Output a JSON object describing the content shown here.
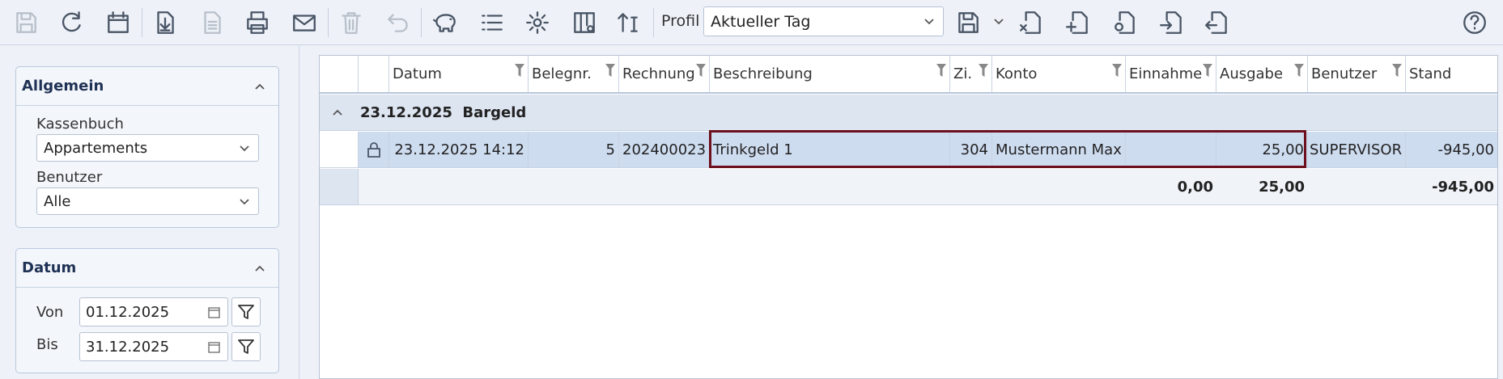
{
  "toolbar": {
    "buttons": [
      {
        "name": "save-icon",
        "enabled": false
      },
      {
        "name": "refresh-icon",
        "enabled": true
      },
      {
        "name": "calendar-icon",
        "enabled": true
      },
      {
        "name": "import-icon",
        "enabled": true
      },
      {
        "name": "document-icon",
        "enabled": false
      },
      {
        "name": "print-icon",
        "enabled": true
      },
      {
        "name": "mail-icon",
        "enabled": true
      },
      {
        "name": "delete-icon",
        "enabled": false
      },
      {
        "name": "undo-icon",
        "enabled": false
      },
      {
        "name": "piggy-bank-icon",
        "enabled": true
      },
      {
        "name": "list-icon",
        "enabled": true
      },
      {
        "name": "settings-icon",
        "enabled": true
      },
      {
        "name": "columns-settings-icon",
        "enabled": true
      },
      {
        "name": "sort-icon",
        "enabled": true
      }
    ],
    "profil_label": "Profil",
    "profil_value": "Aktueller Tag",
    "profile_buttons": [
      "save-profile-icon",
      "delete-profile-icon",
      "new-profile-icon",
      "profile-settings-icon",
      "export-profile-icon",
      "import-profile-icon"
    ],
    "help_icon": "help-icon"
  },
  "sidebar": {
    "allgemein": {
      "title": "Allgemein",
      "kassenbuch_label": "Kassenbuch",
      "kassenbuch_value": "Appartements",
      "benutzer_label": "Benutzer",
      "benutzer_value": "Alle"
    },
    "datum": {
      "title": "Datum",
      "von_label": "Von",
      "von_value": "01.12.2025",
      "bis_label": "Bis",
      "bis_value": "31.12.2025"
    }
  },
  "grid": {
    "columns": [
      "",
      "",
      "Datum",
      "Belegnr.",
      "Rechnung",
      "Beschreibung",
      "Zi.",
      "Konto",
      "Einnahme",
      "Ausgabe",
      "Benutzer",
      "Stand"
    ],
    "group_label": "23.12.2025  Bargeld",
    "row": {
      "lock_icon": "lock-icon",
      "datum": "23.12.2025 14:12",
      "belegnr": "5",
      "rechnung": "202400023",
      "beschreibung": "Trinkgeld 1",
      "zi": "304",
      "konto": "Mustermann Max",
      "einnahme": "",
      "ausgabe": "25,00",
      "benutzer": "SUPERVISOR",
      "stand": "-945,00"
    },
    "totals": {
      "einnahme": "0,00",
      "ausgabe": "25,00",
      "stand": "-945,00"
    }
  }
}
